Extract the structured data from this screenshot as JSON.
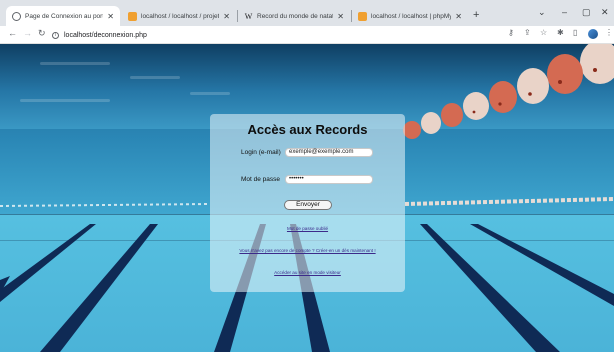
{
  "browser": {
    "tabs": [
      {
        "title": "Page de Connexion au portail",
        "favicon": "globe-icon",
        "active": true
      },
      {
        "title": "localhost / localhost / projet_na",
        "favicon": "phpmyadmin-icon",
        "active": false
      },
      {
        "title": "Record du monde de natation m",
        "favicon": "wikipedia-icon",
        "favicon_text": "W",
        "active": false
      },
      {
        "title": "localhost / localhost | phpMyAd",
        "favicon": "phpmyadmin-icon",
        "active": false
      }
    ],
    "new_tab_label": "+",
    "url": "localhost/deconnexion.php",
    "window_controls": {
      "expand": "⌄",
      "minimize": "–",
      "maximize": "▢",
      "close": "✕"
    }
  },
  "login": {
    "title": "Accès aux Records",
    "email_label": "Login (e-mail)",
    "email_value": "exemple@exemple.com",
    "password_label": "Mot de passe",
    "password_value": "•••••••",
    "submit_label": "Envoyer",
    "forgot_link": "Mot de passe oublié",
    "signup_link": "Vous n'avez pas encore de compte ? Créer-en un dès maintenant !",
    "guest_link": "Accéder au site en mode visiteur"
  },
  "colors": {
    "tab_strip": "#dfe3e8",
    "link": "#3c2a8a",
    "lane_line": "#0f2a55",
    "pool_water": "#4db9dc"
  }
}
